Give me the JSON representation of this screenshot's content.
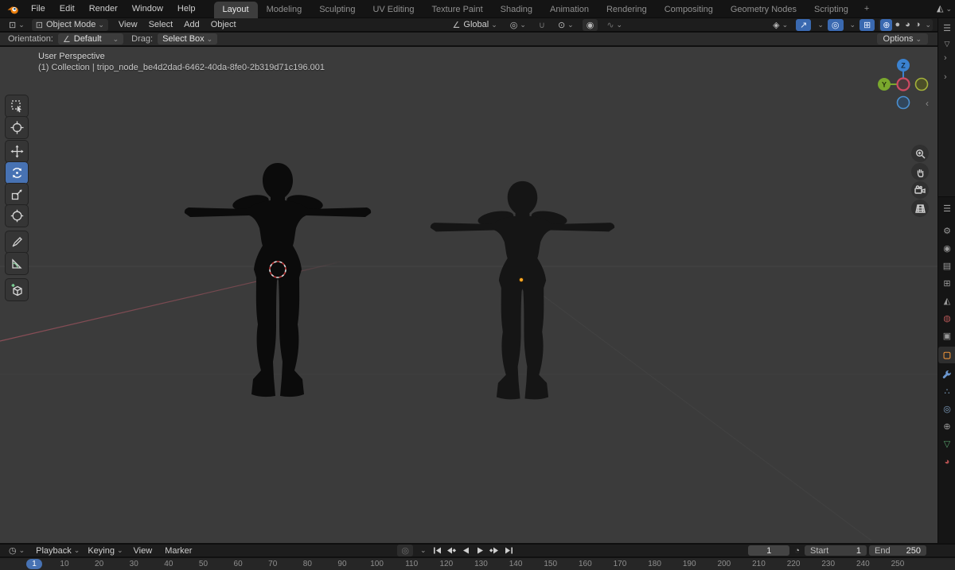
{
  "colors": {
    "accent_blue": "#4772b3",
    "object_orange": "#e8913a",
    "axis_x_red": "#c4384f",
    "axis_y_green": "#7aa82d",
    "axis_z_blue": "#3b82d0",
    "viewport_bg": "#3b3b3b",
    "origin_dot": "#ffa726"
  },
  "icons": {
    "chevron": "⌄",
    "menu": "☰",
    "filter": "▽",
    "gear": "⚙",
    "camera_back": "◉",
    "printer": "▤",
    "layers": "⊞",
    "scene": "◭",
    "world": "◍",
    "collection": "▣",
    "object_square": "▢",
    "particles": "∴",
    "physics": "◎",
    "constraints": "⊕",
    "mesh_data": "▽",
    "material_ball": "◕",
    "clock": "◷",
    "sync": "◎",
    "stopwatch": "◔",
    "editor_3d": "⊡",
    "mode_box": "⊡",
    "orientation_angle": "∠",
    "pivot": "◎",
    "magnet": "∪",
    "snap_target": "⊙",
    "proportional": "◉",
    "falloff_curve": "∿",
    "visibility": "◈",
    "gizmo_arrow": "↗",
    "overlays": "◎",
    "xray": "⊞",
    "shade_wireframe": "⊕",
    "shade_solid": "●",
    "shade_material": "◕",
    "shade_rendered": "◑",
    "collapse_left": "‹",
    "expand_right": "›"
  },
  "topbar": {
    "menus": [
      "File",
      "Edit",
      "Render",
      "Window",
      "Help"
    ],
    "tabs": [
      {
        "label": "Layout",
        "active": true
      },
      {
        "label": "Modeling"
      },
      {
        "label": "Sculpting"
      },
      {
        "label": "UV Editing"
      },
      {
        "label": "Texture Paint"
      },
      {
        "label": "Shading"
      },
      {
        "label": "Animation"
      },
      {
        "label": "Rendering"
      },
      {
        "label": "Compositing"
      },
      {
        "label": "Geometry Nodes"
      },
      {
        "label": "Scripting"
      }
    ],
    "add_tab": "+"
  },
  "viewport_header": {
    "mode": "Object Mode",
    "menus": [
      "View",
      "Select",
      "Add",
      "Object"
    ],
    "orientation": "Global"
  },
  "tool_settings": {
    "orientation_label": "Orientation:",
    "orientation_value": "Default",
    "drag_label": "Drag:",
    "drag_value": "Select Box",
    "options_label": "Options"
  },
  "viewport": {
    "view_label": "User Perspective",
    "collection_path": "(1) Collection | tripo_node_be4d2dad-6462-40da-8fe0-2b319d71c196.001",
    "gizmo": {
      "axis_z": "Z",
      "axis_y": "Y"
    }
  },
  "toolbar": {
    "active_tool": "rotate",
    "tools": [
      "select-box",
      "cursor",
      "move",
      "rotate",
      "scale",
      "transform",
      "annotate",
      "measure",
      "add-cube"
    ]
  },
  "nav_controls": [
    "zoom",
    "pan",
    "camera-view",
    "toggle-projection"
  ],
  "properties": {
    "active_tab": "object",
    "tabs": [
      "tool",
      "render",
      "output",
      "view-layer",
      "scene",
      "world",
      "collection",
      "object",
      "modifiers",
      "particles",
      "physics",
      "constraints",
      "data",
      "material"
    ]
  },
  "timeline": {
    "menus": [
      "Playback",
      "Keying",
      "View",
      "Marker"
    ],
    "transport": [
      "jump-start",
      "prev-keyframe",
      "play-reverse",
      "play",
      "next-keyframe",
      "jump-end"
    ],
    "current_frame": "1",
    "start_label": "Start",
    "start_value": "1",
    "end_label": "End",
    "end_value": "250",
    "ruler_ticks": [
      10,
      20,
      30,
      40,
      50,
      60,
      70,
      80,
      90,
      100,
      110,
      120,
      130,
      140,
      150,
      160,
      170,
      180,
      190,
      200,
      210,
      220,
      230,
      240,
      250
    ]
  }
}
